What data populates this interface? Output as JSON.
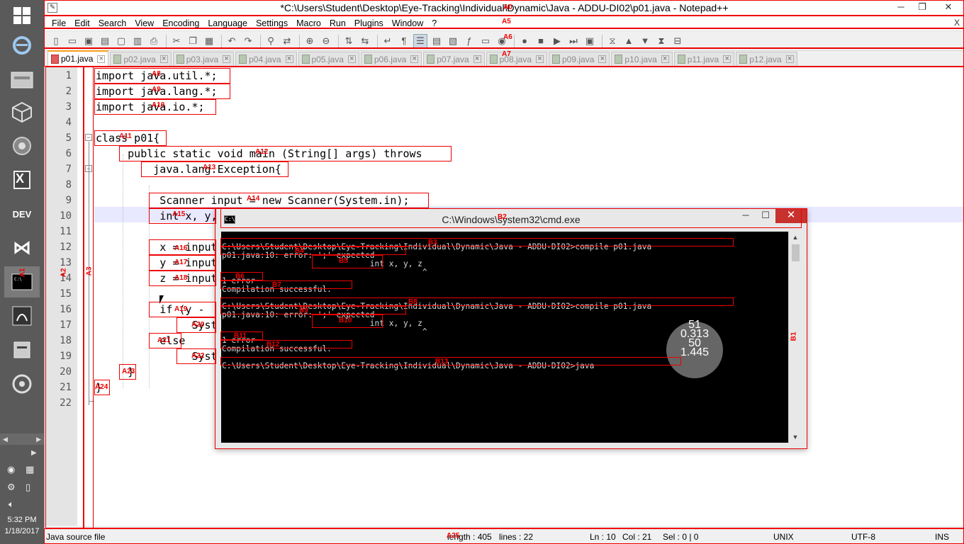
{
  "window": {
    "title": "*C:\\Users\\Student\\Desktop\\Eye-Tracking\\Individual\\Dynamic\\Java - ADDU-DI02\\p01.java - Notepad++",
    "minimize": "─",
    "maximize": "❐",
    "close": "✕"
  },
  "menu": {
    "items": [
      "File",
      "Edit",
      "Search",
      "View",
      "Encoding",
      "Language",
      "Settings",
      "Macro",
      "Run",
      "Plugins",
      "Window",
      "?"
    ],
    "close": "X"
  },
  "tabs": [
    "p01.java",
    "p02.java",
    "p03.java",
    "p04.java",
    "p05.java",
    "p06.java",
    "p07.java",
    "p08.java",
    "p09.java",
    "p10.java",
    "p11.java",
    "p12.java"
  ],
  "active_tab": 0,
  "editor": {
    "line_numbers": [
      "1",
      "2",
      "3",
      "4",
      "5",
      "6",
      "7",
      "8",
      "9",
      "10",
      "11",
      "12",
      "13",
      "14",
      "15",
      "16",
      "17",
      "18",
      "19",
      "20",
      "21",
      "22"
    ],
    "lines": [
      "import java.util.*;",
      "import java.lang.*;",
      "import java.io.*;",
      "",
      "class p01{",
      "     public static void main (String[] args) throws",
      "         java.lang.Exception{",
      "",
      "          Scanner input = new Scanner(System.in);",
      "          int x, y, z",
      "",
      "          x = input",
      "          y = input",
      "          z = input",
      "",
      "          if (y -",
      "               Syste",
      "          else",
      "               Syste",
      "     }",
      "}",
      ""
    ]
  },
  "status": {
    "file_type": "Java source file",
    "length": "length : 405",
    "lines": "lines : 22",
    "ln": "Ln : 10",
    "col": "Col : 21",
    "sel": "Sel : 0 | 0",
    "eol": "UNIX",
    "encoding": "UTF-8",
    "mode": "INS"
  },
  "cmd": {
    "title": "C:\\Windows\\system32\\cmd.exe",
    "minimize": "─",
    "maximize": "☐",
    "close": "✕",
    "lines": [
      "",
      "C:\\Users\\Student\\Desktop\\Eye-Tracking\\Individual\\Dynamic\\Java - ADDU-DI02>compile p01.java",
      "p01.java:10: error: ';' expected",
      "                               int x, y, z",
      "                                          ^",
      "1 error",
      "Compilation successful.",
      "",
      "C:\\Users\\Student\\Desktop\\Eye-Tracking\\Individual\\Dynamic\\Java - ADDU-DI02>compile p01.java",
      "p01.java:10: error: ';' expected",
      "                               int x, y, z",
      "                                          ^",
      "1 error",
      "Compilation successful.",
      "",
      "C:\\Users\\Student\\Desktop\\Eye-Tracking\\Individual\\Dynamic\\Java - ADDU-DI02>java"
    ]
  },
  "gaze": {
    "lines": [
      "51",
      "0.313",
      "50",
      "1.445"
    ]
  },
  "taskbar": {
    "clock_time": "5:32 PM",
    "clock_date": "1/18/2017",
    "icons": [
      "windows-logo-icon",
      "internet-explorer-icon",
      "file-explorer-icon",
      "virtualbox-icon",
      "browser-icon",
      "excel-icon",
      "dev-cpp-icon",
      "visual-studio-icon",
      "cmd-icon",
      "acrobat-icon",
      "app-icon",
      "media-icon"
    ],
    "dev_label": "DEV",
    "excel_label": "X"
  },
  "annotations": {
    "labels": [
      "A0",
      "A5",
      "A6",
      "A7",
      "A8",
      "A9",
      "A10",
      "A11",
      "A12",
      "A13",
      "A14",
      "A15",
      "A16",
      "A17",
      "A18",
      "A19",
      "A20",
      "A21",
      "A22",
      "A23",
      "A24",
      "A25",
      "A1",
      "A2",
      "A3",
      "B1",
      "B2",
      "B3",
      "B4",
      "B5",
      "B6",
      "B7",
      "B8",
      "B9",
      "B10",
      "B11",
      "B12",
      "B13"
    ]
  },
  "colors": {
    "aoi": "#ee0000",
    "tab_accent": "#f8a11b",
    "current_line": "#e8e8ff",
    "cmd_close": "#c7322e"
  }
}
